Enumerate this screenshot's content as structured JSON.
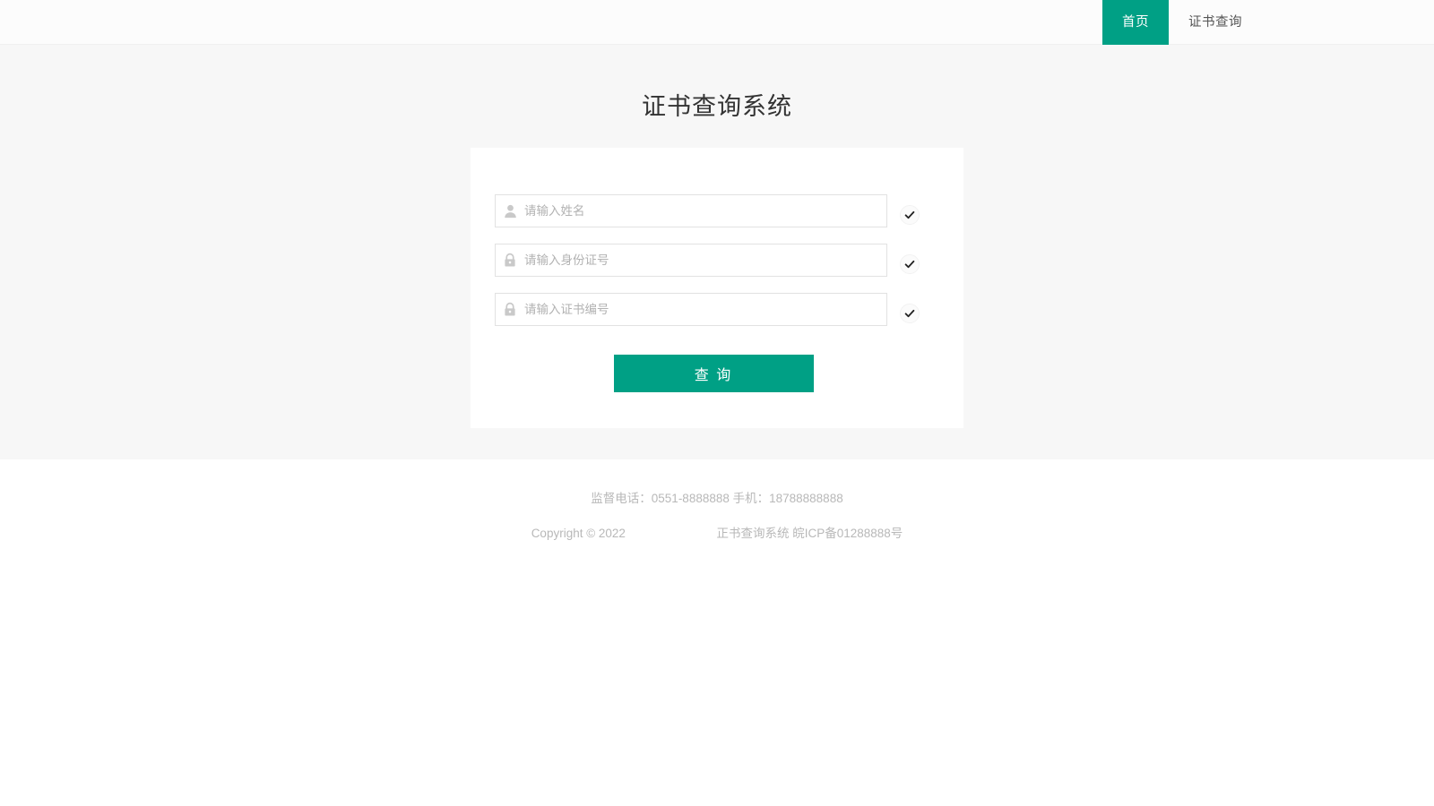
{
  "navbar": {
    "items": [
      {
        "label": "首页",
        "active": true,
        "name": "nav-item-home"
      },
      {
        "label": "证书查询",
        "active": false,
        "name": "nav-item-certificate-query"
      }
    ]
  },
  "main": {
    "title": "证书查询系统"
  },
  "form": {
    "fields": [
      {
        "icon": "user-icon",
        "placeholder": "请输入姓名",
        "value": "",
        "name": "name-input",
        "valid_icon": "check-circle-icon"
      },
      {
        "icon": "lock-icon",
        "placeholder": "请输入身份证号",
        "value": "",
        "name": "id-number-input",
        "valid_icon": "check-circle-icon"
      },
      {
        "icon": "lock-icon",
        "placeholder": "请输入证书编号",
        "value": "",
        "name": "certificate-number-input",
        "valid_icon": "check-circle-icon"
      }
    ],
    "submit_label": "查 询"
  },
  "footer": {
    "contact": "监督电话：0551-8888888  手机：18788888888",
    "copyright_left": "Copyright © 2022",
    "copyright_right": "正书查询系统 皖ICP备01288888号"
  },
  "colors": {
    "accent": "#00a085",
    "page_bg": "#f7f7f7",
    "card_bg": "#ffffff",
    "title_text": "#333333",
    "muted_text": "#b8b8b8"
  }
}
